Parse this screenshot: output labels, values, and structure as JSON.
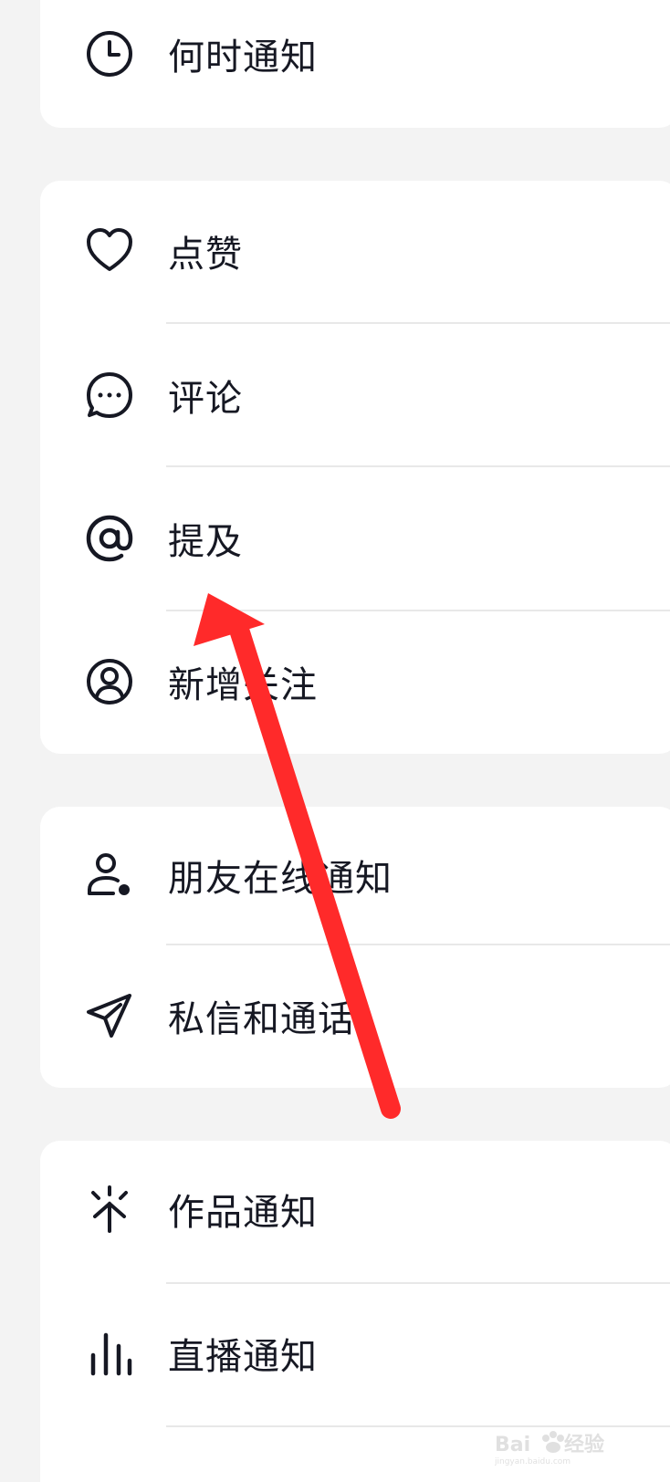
{
  "cards": [
    {
      "items": [
        {
          "label": "何时通知",
          "icon": "clock-icon"
        }
      ]
    },
    {
      "items": [
        {
          "label": "点赞",
          "icon": "heart-icon"
        },
        {
          "label": "评论",
          "icon": "comment-icon"
        },
        {
          "label": "提及",
          "icon": "at-icon"
        },
        {
          "label": "新增关注",
          "icon": "user-circle-icon"
        }
      ]
    },
    {
      "items": [
        {
          "label": "朋友在线通知",
          "icon": "user-online-icon"
        },
        {
          "label": "私信和通话",
          "icon": "send-icon"
        }
      ]
    },
    {
      "items": [
        {
          "label": "作品通知",
          "icon": "sparkle-icon"
        },
        {
          "label": "直播通知",
          "icon": "bars-icon"
        }
      ]
    }
  ],
  "annotation": {
    "color": "#ff2a2a"
  },
  "watermark": {
    "text": "Baidu 经验",
    "subtext": "jingyan.baidu.com"
  }
}
